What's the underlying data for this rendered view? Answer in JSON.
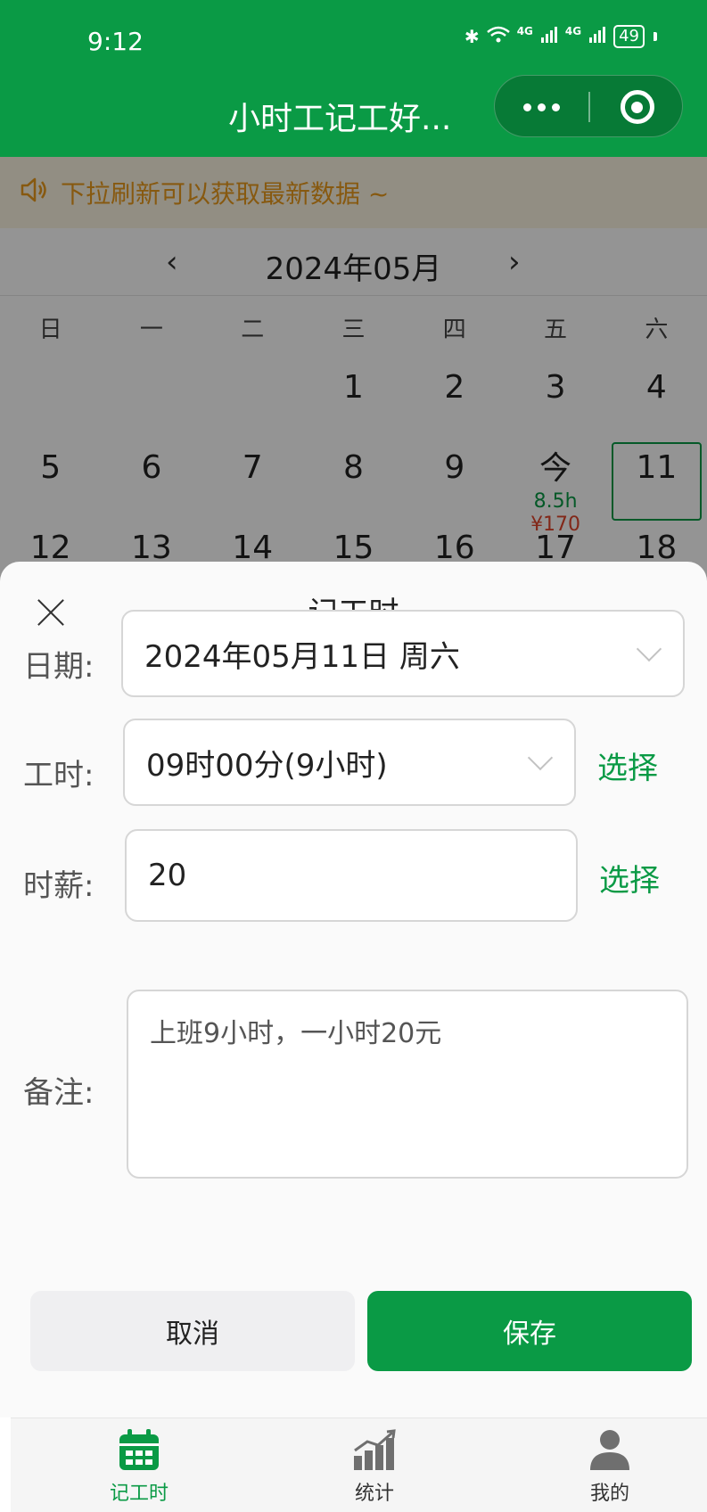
{
  "status_bar": {
    "time": "9:12",
    "bluetooth_icon": "bluetooth-icon",
    "wifi_icon": "wifi-icon",
    "network_1": "4G",
    "network_2": "4G",
    "battery": "49"
  },
  "header": {
    "title": "小时工记工好...",
    "more_icon": "more-dots-icon",
    "close_icon": "target-circle-icon"
  },
  "notice": {
    "icon": "speaker-icon",
    "text": "下拉刷新可以获取最新数据 ~"
  },
  "calendar": {
    "prev": "‹",
    "next": "›",
    "month_label": "2024年05月",
    "weekdays": [
      "日",
      "一",
      "二",
      "三",
      "四",
      "五",
      "六"
    ],
    "days": {
      "d1": "1",
      "d2": "2",
      "d3": "3",
      "d4": "4",
      "d5": "5",
      "d6": "6",
      "d7": "7",
      "d8": "8",
      "d9": "9",
      "today": "今",
      "today_hours": "8.5h",
      "today_money": "¥170",
      "d11": "11",
      "d12": "12",
      "d13": "13",
      "d14": "14",
      "d15": "15",
      "d16": "16",
      "d17": "17",
      "d18": "18"
    }
  },
  "sheet": {
    "title": "记工时",
    "date_label": "日期:",
    "date_value": "2024年05月11日 周六",
    "hours_label": "工时:",
    "hours_value": "09时00分(9小时)",
    "hours_pick": "选择",
    "wage_label": "时薪:",
    "wage_value": "20",
    "wage_pick": "选择",
    "note_label": "备注:",
    "note_value": "上班9小时，一小时20元",
    "cancel": "取消",
    "save": "保存"
  },
  "tabbar": {
    "home": "记工时",
    "stats": "统计",
    "mine": "我的"
  },
  "colors": {
    "brand_green": "#0a9a45",
    "money_red": "#e0452c",
    "notice_orange": "#e99a1c"
  }
}
